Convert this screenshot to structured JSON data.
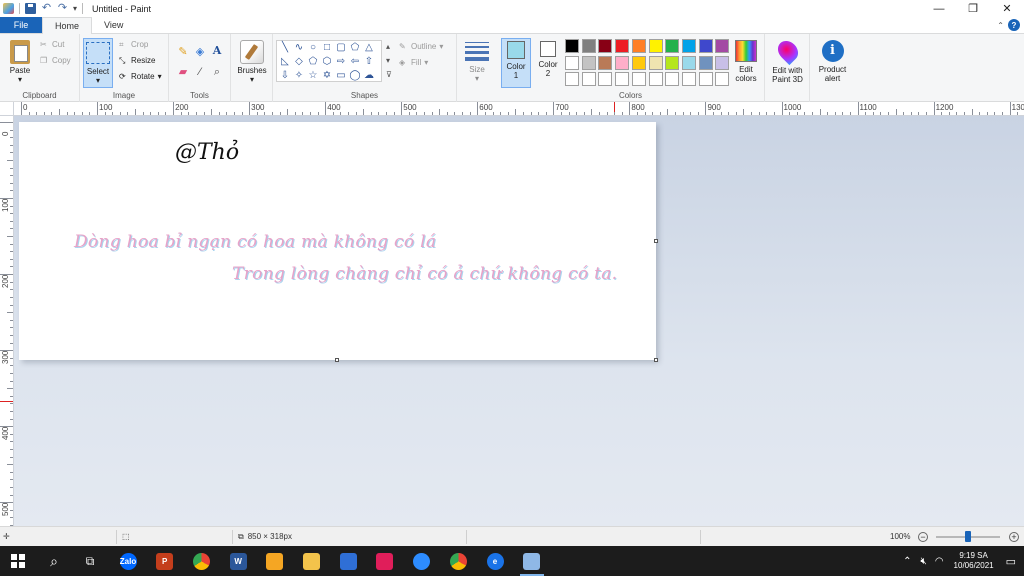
{
  "window": {
    "title": "Untitled - Paint",
    "controls": {
      "minimize": "—",
      "maximize": "❐",
      "close": "✕"
    }
  },
  "tabs": [
    {
      "label": "File"
    },
    {
      "label": "Home"
    },
    {
      "label": "View"
    }
  ],
  "ribbon": {
    "clipboard": {
      "label": "Clipboard",
      "paste": "Paste",
      "cut": "Cut",
      "copy": "Copy"
    },
    "image": {
      "label": "Image",
      "select": "Select",
      "crop": "Crop",
      "resize": "Resize",
      "rotate": "Rotate"
    },
    "tools": {
      "label": "Tools"
    },
    "brushes": {
      "label": "Brushes"
    },
    "shapes": {
      "label": "Shapes",
      "outline": "Outline",
      "fill": "Fill"
    },
    "size": {
      "label": "Size"
    },
    "colors": {
      "label": "Colors",
      "color1_line1": "Color",
      "color1_line2": "1",
      "color2_line1": "Color",
      "color2_line2": "2",
      "color1": "#99d9ea",
      "color2": "#ffffff",
      "edit_line1": "Edit",
      "edit_line2": "colors",
      "palette_row1": [
        "#000000",
        "#7f7f7f",
        "#880015",
        "#ed1c24",
        "#ff7f27",
        "#fff200",
        "#22b14c",
        "#00a2e8",
        "#3f48cc",
        "#a349a4"
      ],
      "palette_row2": [
        "#ffffff",
        "#c3c3c3",
        "#b97a57",
        "#ffaec9",
        "#ffc90e",
        "#efe4b0",
        "#b5e61d",
        "#99d9ea",
        "#7092be",
        "#c8bfe7"
      ],
      "palette_row3": [
        "#ffffff",
        "#ffffff",
        "#ffffff",
        "#ffffff",
        "#ffffff",
        "#ffffff",
        "#ffffff",
        "#ffffff",
        "#ffffff",
        "#ffffff"
      ]
    },
    "paint3d": {
      "line1": "Edit with",
      "line2": "Paint 3D"
    },
    "alert": {
      "line1": "Product",
      "line2": "alert"
    }
  },
  "ruler": {
    "h_labels": [
      "0",
      "100",
      "200",
      "300",
      "400",
      "500",
      "600",
      "700",
      "800",
      "900",
      "1000",
      "1100",
      "1200",
      "1300"
    ],
    "v_labels": [
      "0",
      "100",
      "200",
      "300",
      "400",
      "500"
    ]
  },
  "canvas": {
    "signature": "@Thỏ",
    "line1": "Dòng hoa bỉ ngạn có hoa mà không có lá",
    "line2": "Trong lòng chàng chỉ có ả chứ không có ta."
  },
  "status": {
    "dimensions": "850 × 318px",
    "zoom": "100%"
  },
  "taskbar": {
    "apps": [
      {
        "name": "zalo",
        "text": "Zalo",
        "color": "#0068ff"
      },
      {
        "name": "powerpoint",
        "text": "P",
        "color": "#c43e1c"
      },
      {
        "name": "chrome",
        "text": "",
        "color": "#34a853"
      },
      {
        "name": "word",
        "text": "W",
        "color": "#2b579a"
      },
      {
        "name": "app-orange",
        "text": "",
        "color": "#f5a623"
      },
      {
        "name": "file-explorer",
        "text": "",
        "color": "#f3c34b"
      },
      {
        "name": "app-blue",
        "text": "",
        "color": "#2f6fd6"
      },
      {
        "name": "app-slack",
        "text": "",
        "color": "#e01e5a"
      },
      {
        "name": "zoom",
        "text": "",
        "color": "#2d8cff"
      },
      {
        "name": "chrome-2",
        "text": "",
        "color": "#34a853"
      },
      {
        "name": "edge",
        "text": "e",
        "color": "#1a73e8"
      },
      {
        "name": "paint",
        "text": "",
        "color": "#8fb8e6"
      }
    ],
    "time": "9:19 SA",
    "date": "10/06/2021"
  }
}
